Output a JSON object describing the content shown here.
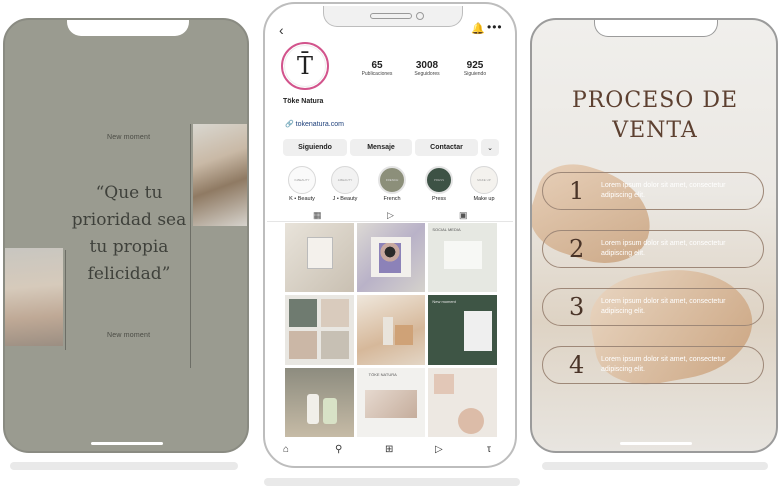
{
  "left_story": {
    "top_caption": "New moment",
    "quote": "“Que tu prioridad sea tu propia felicidad”",
    "bottom_caption": "New moment"
  },
  "profile": {
    "logo_letter": "T̄",
    "name": "Töke Natura",
    "link": "tokenatura.com",
    "stats": [
      {
        "value": "65",
        "label": "Publicaciones"
      },
      {
        "value": "3008",
        "label": "Seguidores"
      },
      {
        "value": "925",
        "label": "Siguiendo"
      }
    ],
    "buttons": {
      "following": "Siguiendo",
      "message": "Mensaje",
      "contact": "Contactar"
    },
    "highlights": [
      "K • Beauty",
      "J • Beauty",
      "French",
      "Press",
      "Make up"
    ],
    "colors": {
      "ring": "#d2548c",
      "highlight_dark": "#3d5245",
      "highlight_olive": "#8c8f7a"
    }
  },
  "grid_tiles": [
    {
      "text": ""
    },
    {
      "text": ""
    },
    {
      "text": "SOCIAL MEDIA"
    },
    {
      "text": ""
    },
    {
      "text": ""
    },
    {
      "text": "New moment"
    },
    {
      "text": ""
    },
    {
      "text": "TÖKE NATURA"
    },
    {
      "text": ""
    }
  ],
  "right_story": {
    "title_line1": "PROCESO DE",
    "title_line2": "VENTA",
    "steps": [
      {
        "num": "1",
        "text": "Lorem ipsum dolor sit amet, consectetur adipiscing elit."
      },
      {
        "num": "2",
        "text": "Lorem ipsum dolor sit amet, consectetur adipiscing elit."
      },
      {
        "num": "3",
        "text": "Lorem ipsum dolor sit amet, consectetur adipiscing elit."
      },
      {
        "num": "4",
        "text": "Lorem ipsum dolor sit amet, consectetur adipiscing elit."
      }
    ]
  }
}
